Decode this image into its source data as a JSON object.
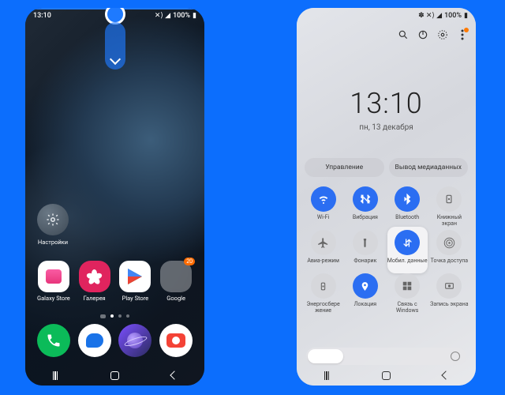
{
  "status": {
    "time": "13:10",
    "battery": "100%",
    "signal_icons": "⟨i⟩ ⊘ ◢"
  },
  "home": {
    "settings_label": "Настройки",
    "apps": {
      "galaxy_store": "Galaxy Store",
      "gallery": "Галерея",
      "play_store": "Play Store",
      "google": "Google",
      "google_badge": "20"
    }
  },
  "panel": {
    "time": "13:10",
    "date": "пн, 13 декабря",
    "pills": {
      "control": "Управление",
      "media": "Вывод медиаданных"
    },
    "tiles": {
      "wifi": "Wi-Fi",
      "vibration": "Вибрация",
      "bluetooth": "Bluetooth",
      "book_screen": "Книжный экран",
      "airplane": "Авиа-режим",
      "flashlight": "Фонарик",
      "mobile_data": "Мобил. данные",
      "hotspot": "Точка доступа",
      "power_save": "Энергосбере жение",
      "location": "Локация",
      "windows_link": "Связь с Windows",
      "screen_rec": "Запись экрана"
    }
  }
}
